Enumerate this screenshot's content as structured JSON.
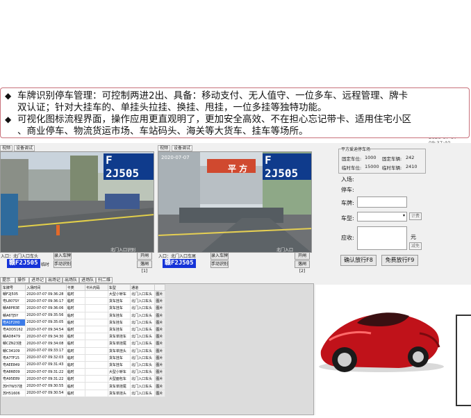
{
  "banner": {
    "bullet1": "◆",
    "line1": "车牌识别停车管理：可控制两进2出、具备：移动支付、无人值守、一位多车、远程管理、牌卡",
    "line2": "双认证；针对大挂车的、单挂头拉挂、换挂、甩挂，一位多挂等独特功能。",
    "bullet2": "◆",
    "line3": "可视化图标流程界面，操作应用更直观明了，更加安全高效、不在担心忘记带卡、适用住宅小区",
    "line4": "、商业停车、物流货运市场、车站码头、海关等大货车、挂车等场所。"
  },
  "timestamp": "2020-07-07 09:37:40",
  "camera_left": {
    "tab1": "视频",
    "tab2": "设备调试",
    "overlay_plate": "F 2J505",
    "label": "北门入口识别",
    "gate_label": "入口：北门入口车头",
    "btn_record": "录入车牌",
    "btn_open": "开闸[1]",
    "btn_manual": "手动识别",
    "btn_close": "落闸[1]",
    "plate": "赣F2J505",
    "type": "临时"
  },
  "camera_right": {
    "tab1": "视频",
    "tab2": "设备调试",
    "overlay_time": "2020-07-07",
    "overlay_plate": "F 2J505",
    "sign": "平 方",
    "label": "北门入口",
    "gate_label": "入口：北门入口车尾",
    "btn_record": "录入车牌",
    "btn_open": "开闸[2]",
    "btn_manual": "手动识别",
    "btn_close": "落闸[2]",
    "plate": "赣F2J505"
  },
  "info_panel": {
    "title": "平方爱迪停车场",
    "fixed_spaces_label": "固定车位:",
    "fixed_spaces": "1000",
    "fixed_cars_label": "固定车辆:",
    "fixed_cars": "242",
    "temp_spaces_label": "临时车位:",
    "temp_spaces": "15000",
    "temp_cars_label": "临时车辆:",
    "temp_cars": "2410",
    "entry_label": "入场:",
    "park_label": "停车:",
    "plate_label": "车牌:",
    "type_label": "车型:",
    "calc_btn": "计费",
    "due_label": "应收:",
    "unit": "元",
    "discount_btn": "减免",
    "confirm_btn": "确认放行F8",
    "free_btn": "免费放行F9"
  },
  "record_tabs": [
    "提示信息",
    "操作员",
    "进场记录",
    "出场记录",
    "出场队列",
    "进场队列",
    "扫二维码"
  ],
  "table": {
    "headers": [
      "车牌号",
      "入场时间",
      "卡类",
      "卡片内码",
      "车型",
      "通道",
      ""
    ],
    "rows": [
      [
        "赣F2J505",
        "2020-07-07 09:36:28",
        "临时",
        "",
        "大型小轿车",
        "北门入口车头",
        "图片"
      ],
      [
        "粤L807SY",
        "2020-07-07 09:36:17",
        "临时",
        "",
        "货车挂车",
        "北门入口车头",
        "图片"
      ],
      [
        "赣A8P83E",
        "2020-07-07 09:36:06",
        "临时",
        "",
        "货车挂车",
        "北门入口车头",
        "图片"
      ],
      [
        "赣A6TJ5Y",
        "2020-07-07 09:35:56",
        "临时",
        "",
        "货车挂车",
        "北门入口车头",
        "图片"
      ],
      [
        "粤A1F2H0",
        "2020-07-07 09:35:05",
        "临时",
        "",
        "货车挂车",
        "北门入口车头",
        "图片"
      ],
      [
        "粤ADD5162",
        "2020-07-07 09:34:54",
        "临时",
        "",
        "货车挂车",
        "北门入口车头",
        "图片"
      ],
      [
        "赣AD8479",
        "2020-07-07 09:34:30",
        "临时",
        "",
        "货车单挂车",
        "北门入口车头",
        "图片"
      ],
      [
        "赣CZN23挂",
        "2020-07-07 09:34:08",
        "临时",
        "",
        "货车单挂尾",
        "北门入口车头",
        "图片"
      ],
      [
        "赣C34109",
        "2020-07-07 09:33:17",
        "临时",
        "",
        "货车单挂头",
        "北门入口车头",
        "图片"
      ],
      [
        "粤A7TF15",
        "2020-07-07 09:32:03",
        "临时",
        "",
        "货车挂车",
        "北门入口车头",
        "图片"
      ],
      [
        "粤AEE849",
        "2020-07-07 09:31:43",
        "临时",
        "",
        "货车挂车",
        "北门入口车头",
        "图片"
      ],
      [
        "粤A8RE09",
        "2020-07-07 09:31:22",
        "临时",
        "",
        "大型小轿车",
        "北门入口车头",
        "图片"
      ],
      [
        "粤A95E89",
        "2020-07-07 09:31:22",
        "临时",
        "",
        "大型面包车",
        "北门入口车头",
        "图片"
      ],
      [
        "苏H7W37挂",
        "2020-07-07 09:30:55",
        "临时",
        "",
        "货车单挂尾",
        "北门入口车头",
        "图片"
      ],
      [
        "苏H51606",
        "2020-07-07 09:30:54",
        "临时",
        "",
        "货车单挂头",
        "北门入口车头",
        "图片"
      ]
    ]
  },
  "colors": {
    "banner_border": "#c8707a",
    "plate_blue": "#1533d8",
    "car_red": "#c0121a"
  }
}
